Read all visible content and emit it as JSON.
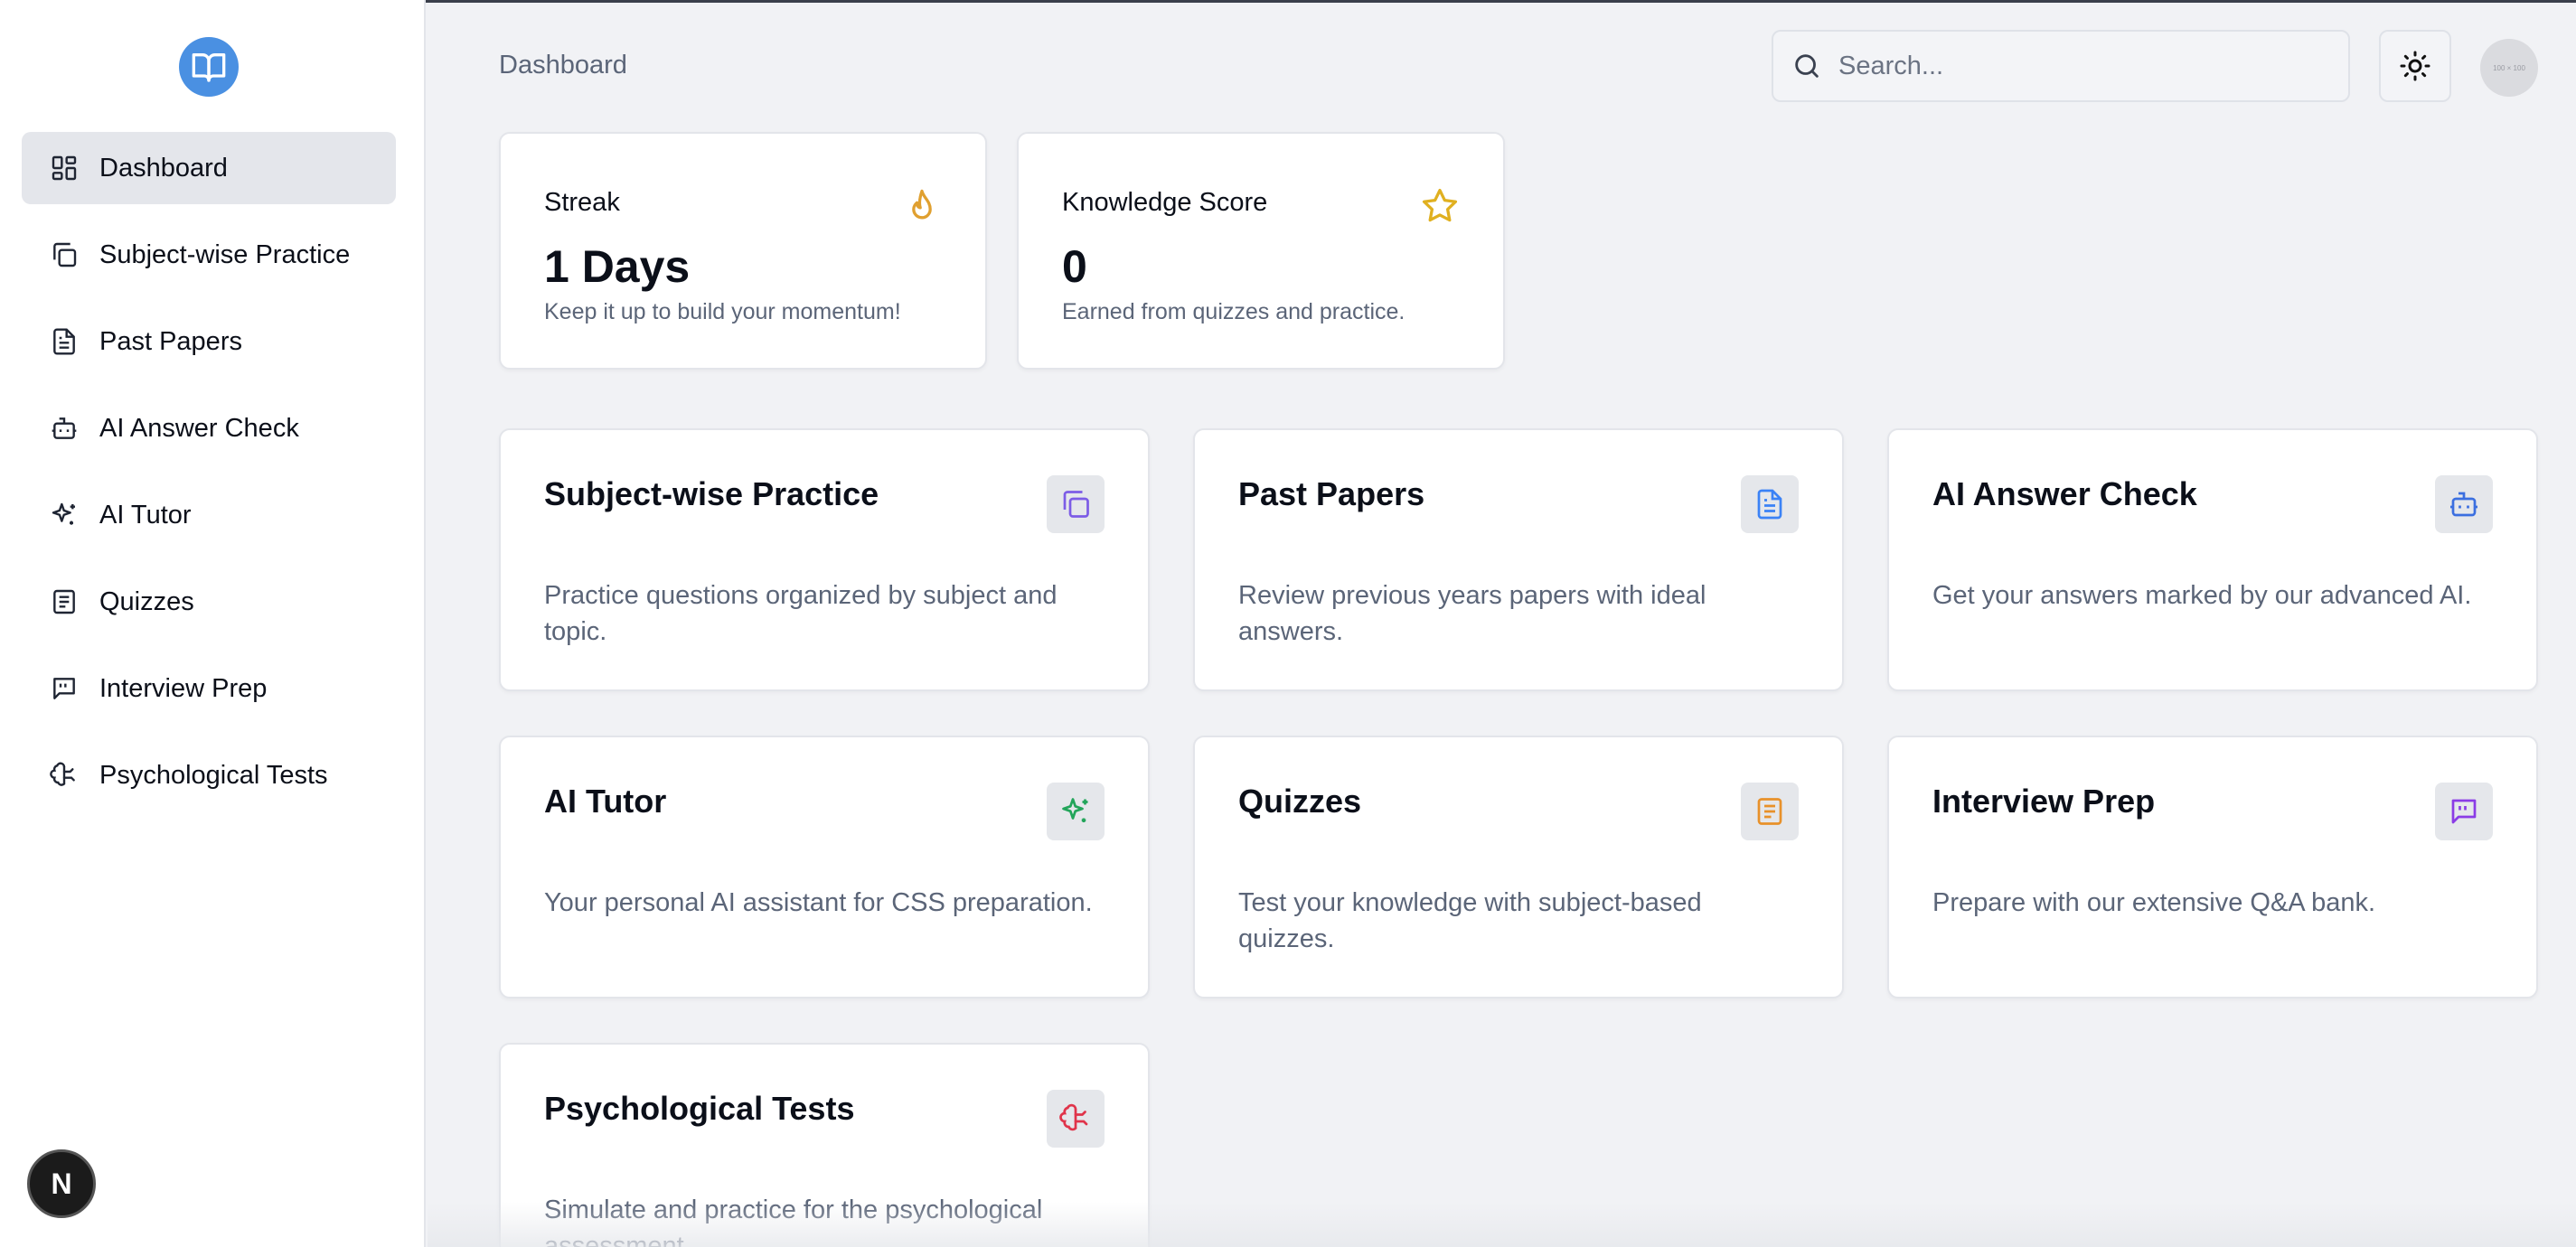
{
  "sidebar": {
    "logo_icon": "book-open-icon",
    "items": [
      {
        "label": "Dashboard",
        "icon": "dashboard-icon",
        "active": true
      },
      {
        "label": "Subject-wise Practice",
        "icon": "copy-icon"
      },
      {
        "label": "Past Papers",
        "icon": "file-text-icon"
      },
      {
        "label": "AI Answer Check",
        "icon": "bot-icon"
      },
      {
        "label": "AI Tutor",
        "icon": "sparkles-icon"
      },
      {
        "label": "Quizzes",
        "icon": "list-icon"
      },
      {
        "label": "Interview Prep",
        "icon": "message-quote-icon"
      },
      {
        "label": "Psychological Tests",
        "icon": "brain-icon"
      }
    ],
    "badge_letter": "N"
  },
  "header": {
    "breadcrumb": "Dashboard",
    "search_placeholder": "Search...",
    "avatar_text": "100 × 100"
  },
  "stats": [
    {
      "title": "Streak",
      "value": "1 Days",
      "desc": "Keep it up to build your momentum!",
      "icon": "flame-icon",
      "color": "#e0a030"
    },
    {
      "title": "Knowledge Score",
      "value": "0",
      "desc": "Earned from quizzes and practice.",
      "icon": "star-icon",
      "color": "#e0b020"
    }
  ],
  "features": [
    {
      "title": "Subject-wise Practice",
      "desc": "Practice questions organized by subject and topic.",
      "icon": "copy-icon",
      "color": "#7c5ce6"
    },
    {
      "title": "Past Papers",
      "desc": "Review previous years papers with ideal answers.",
      "icon": "file-text-icon",
      "color": "#3b82f6"
    },
    {
      "title": "AI Answer Check",
      "desc": "Get your answers marked by our advanced AI.",
      "icon": "bot-icon",
      "color": "#3b6fe0"
    },
    {
      "title": "AI Tutor",
      "desc": "Your personal AI assistant for CSS preparation.",
      "icon": "sparkles-icon",
      "color": "#22a55a"
    },
    {
      "title": "Quizzes",
      "desc": "Test your knowledge with subject-based quizzes.",
      "icon": "list-icon",
      "color": "#e8912a"
    },
    {
      "title": "Interview Prep",
      "desc": "Prepare with our extensive Q&A bank.",
      "icon": "message-quote-icon",
      "color": "#8b3ce6"
    },
    {
      "title": "Psychological Tests",
      "desc": "Simulate and practice for the psychological assessment.",
      "icon": "brain-icon",
      "color": "#e0344a"
    }
  ]
}
